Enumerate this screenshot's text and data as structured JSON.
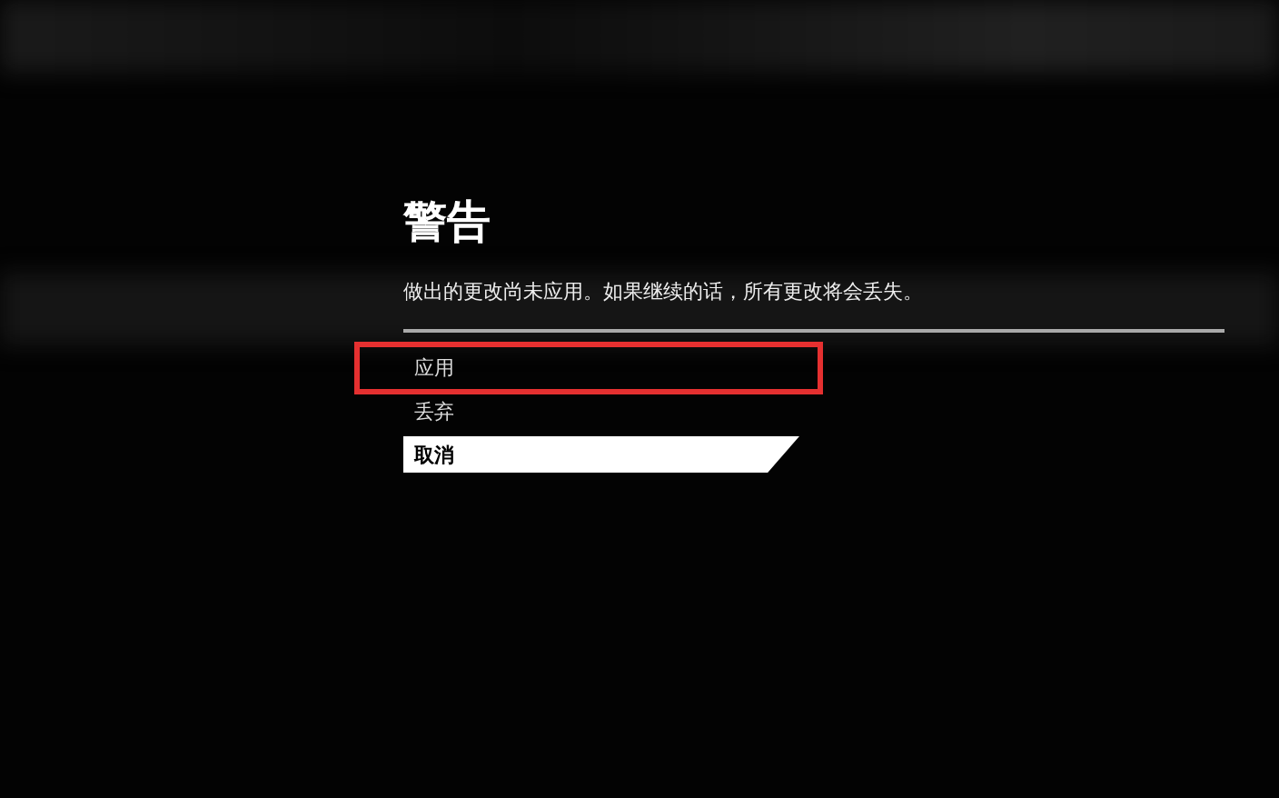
{
  "dialog": {
    "title": "警告",
    "message": "做出的更改尚未应用。如果继续的话，所有更改将会丢失。"
  },
  "options": [
    {
      "label": "应用",
      "selected": false,
      "highlighted": true
    },
    {
      "label": "丢弃",
      "selected": false,
      "highlighted": false
    },
    {
      "label": "取消",
      "selected": true,
      "highlighted": false
    }
  ]
}
